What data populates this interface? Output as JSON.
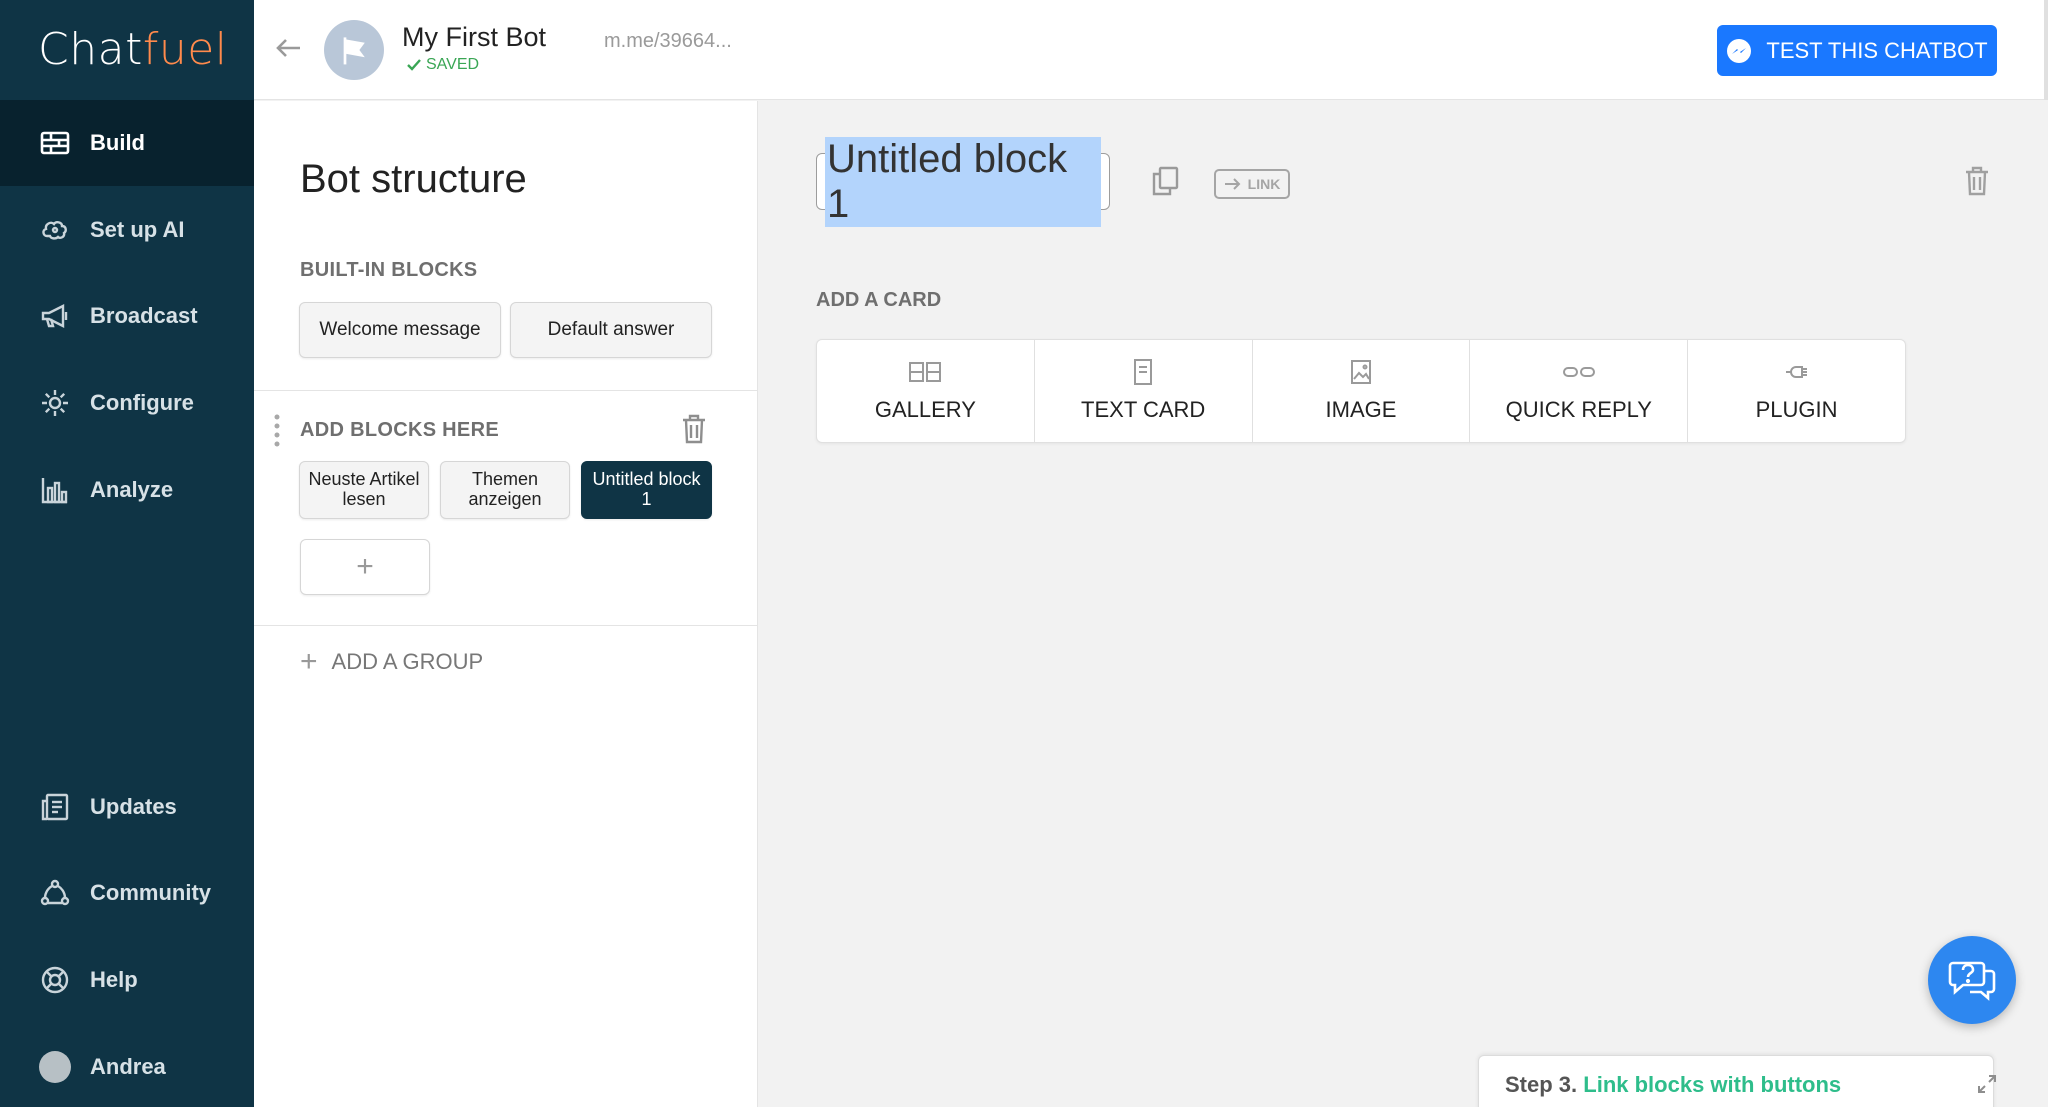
{
  "app": {
    "logo_prefix": "Chat",
    "logo_suffix": "fuel",
    "brand_color": "#0f3445",
    "accent_color": "#1a78ff"
  },
  "sidebar": {
    "items": [
      {
        "label": "Build",
        "icon": "build-icon",
        "active": true
      },
      {
        "label": "Set up AI",
        "icon": "ai-brain-icon"
      },
      {
        "label": "Broadcast",
        "icon": "megaphone-icon"
      },
      {
        "label": "Configure",
        "icon": "gear-icon"
      },
      {
        "label": "Analyze",
        "icon": "bar-chart-icon"
      }
    ],
    "bottom_items": [
      {
        "label": "Updates",
        "icon": "updates-icon"
      },
      {
        "label": "Community",
        "icon": "community-icon"
      },
      {
        "label": "Help",
        "icon": "lifebuoy-icon"
      },
      {
        "label": "Andrea",
        "icon": "user-avatar"
      }
    ]
  },
  "header": {
    "bot_name": "My First Bot",
    "status": "SAVED",
    "bot_url": "m.me/39664...",
    "test_button": "TEST THIS CHATBOT"
  },
  "structure": {
    "title": "Bot structure",
    "built_in_label": "BUILT-IN BLOCKS",
    "built_in_blocks": [
      "Welcome message",
      "Default answer"
    ],
    "group_label": "ADD BLOCKS HERE",
    "group_blocks": [
      {
        "line1": "Neuste Artikel",
        "line2": "lesen"
      },
      {
        "line1": "Themen",
        "line2": "anzeigen"
      },
      {
        "line1": "Untitled block",
        "line2": "1",
        "active": true
      }
    ],
    "add_block": "+",
    "add_group": "ADD A GROUP"
  },
  "editor": {
    "block_title": "Untitled block 1",
    "link_badge": "LINK",
    "add_card_label": "ADD A CARD",
    "card_options": [
      "GALLERY",
      "TEXT CARD",
      "IMAGE",
      "QUICK REPLY",
      "PLUGIN"
    ]
  },
  "onboarding": {
    "step_prefix": "Step 3.",
    "step_text": "Link blocks with buttons"
  }
}
